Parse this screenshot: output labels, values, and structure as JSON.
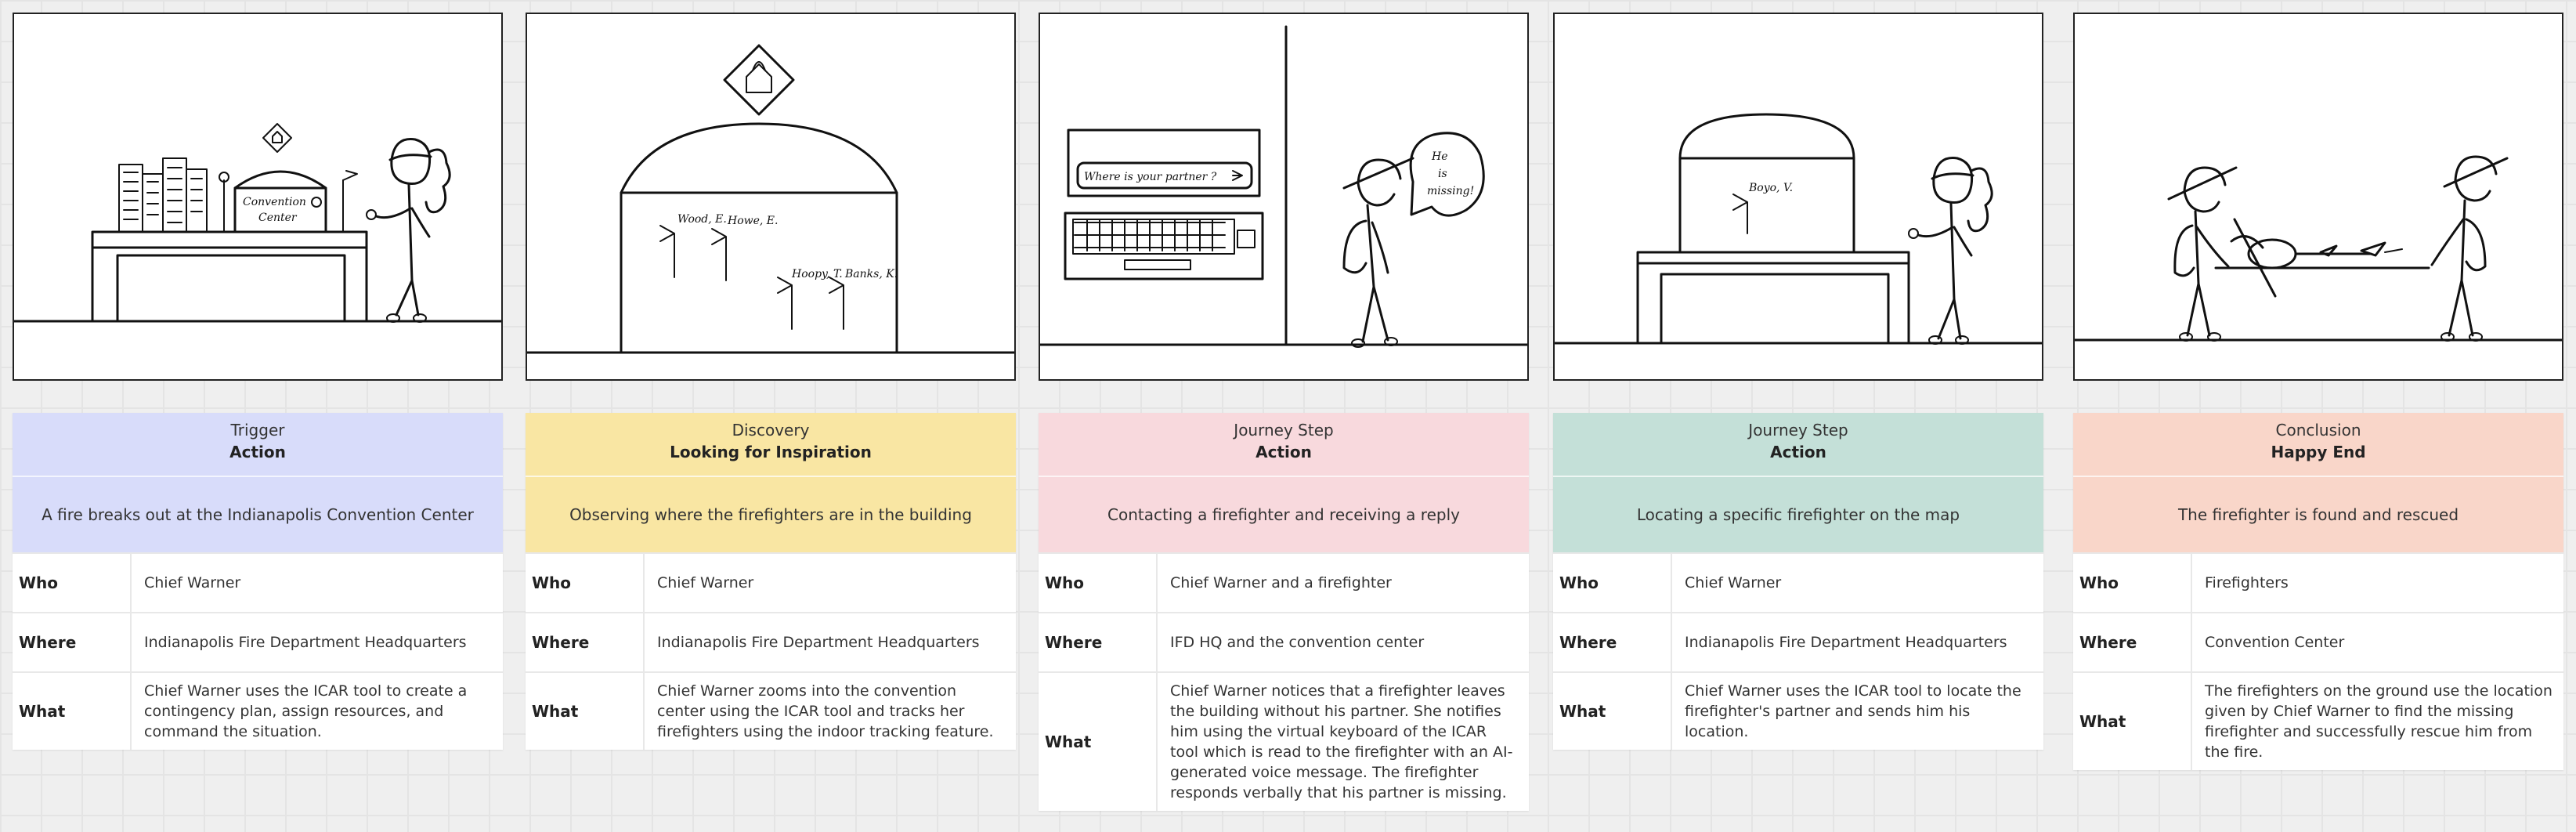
{
  "labels": {
    "who": "Who",
    "where": "Where",
    "what": "What"
  },
  "steps": [
    {
      "type": "Trigger",
      "title": "Action",
      "description": "A fire breaks out at the Indianapolis Convention Center",
      "who": "Chief Warner",
      "where": "Indianapolis Fire Department Headquarters",
      "what": "Chief Warner uses the ICAR tool to create a contingency plan, assign resources, and command the situation.",
      "color": "#d8dcfa",
      "sketch_text": [
        "Convention",
        "Center"
      ]
    },
    {
      "type": "Discovery",
      "title": "Looking for Inspiration",
      "description": "Observing where the firefighters are in the building",
      "who": "Chief Warner",
      "where": "Indianapolis Fire Department Headquarters",
      "what": "Chief Warner zooms into the convention center using the ICAR tool and tracks her firefighters using the indoor tracking feature.",
      "color": "#f9e6a3",
      "sketch_text": [
        "Wood, E.",
        "Howe, E.",
        "Hoopy, T.",
        "Banks, K."
      ]
    },
    {
      "type": "Journey Step",
      "title": "Action",
      "description": "Contacting a firefighter and receiving a reply",
      "who": "Chief Warner and a firefighter",
      "where": "IFD HQ and the convention center",
      "what": "Chief Warner notices  that a firefighter leaves the building without his partner. She notifies him using the virtual keyboard of the ICAR tool which is read to the firefighter with an AI-generated voice message. The firefighter responds verbally that his partner is missing.",
      "color": "#f8d9dd",
      "sketch_text": [
        "Where is your partner ?",
        "He",
        "is",
        "missing!"
      ]
    },
    {
      "type": "Journey Step",
      "title": "Action",
      "description": "Locating a specific firefighter on the map",
      "who": "Chief Warner",
      "where": "Indianapolis Fire Department Headquarters",
      "what": "Chief Warner uses the ICAR tool to locate the firefighter's partner and sends him his location.",
      "color": "#c4e0d8",
      "sketch_text": [
        "Boyo, V."
      ]
    },
    {
      "type": "Conclusion",
      "title": "Happy End",
      "description": "The firefighter is found and rescued",
      "who": "Firefighters",
      "where": "Convention Center",
      "what": "The firefighters on the ground use the location given by Chief Warner to find the missing firefighter and successfully rescue him from the fire.",
      "color": "#f9d6c9",
      "sketch_text": []
    }
  ]
}
